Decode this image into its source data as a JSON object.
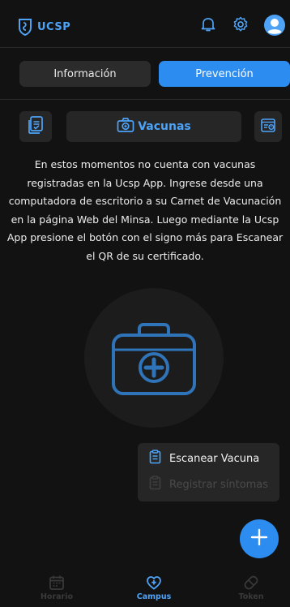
{
  "header": {
    "logo_text": "UCSP",
    "icons": [
      "bell-icon",
      "gear-icon",
      "user-avatar-icon"
    ]
  },
  "tabs": [
    {
      "label": "Información",
      "active": false
    },
    {
      "label": "Prevención",
      "active": true
    }
  ],
  "subnav": {
    "vaccines_label": "Vacunas"
  },
  "message": "En estos momentos no cuenta con vacunas registradas en la Ucsp App. Ingrese desde una computadora de escritorio a su Carnet de Vacunación en la página Web del Minsa. Luego mediante la Ucsp App presione el botón con el signo más para Escanear el QR de su certificado.",
  "fab_menu": {
    "items": [
      {
        "label": "Escanear Vacuna",
        "enabled": true
      },
      {
        "label": "Registrar síntomas",
        "enabled": false
      }
    ]
  },
  "bottom_nav": {
    "items": [
      {
        "label": "Horario",
        "active": false
      },
      {
        "label": "Campus",
        "active": true
      },
      {
        "label": "Token",
        "active": false
      }
    ]
  },
  "colors": {
    "accent": "#2d8cf0",
    "background": "#121212",
    "surface": "#262626"
  }
}
